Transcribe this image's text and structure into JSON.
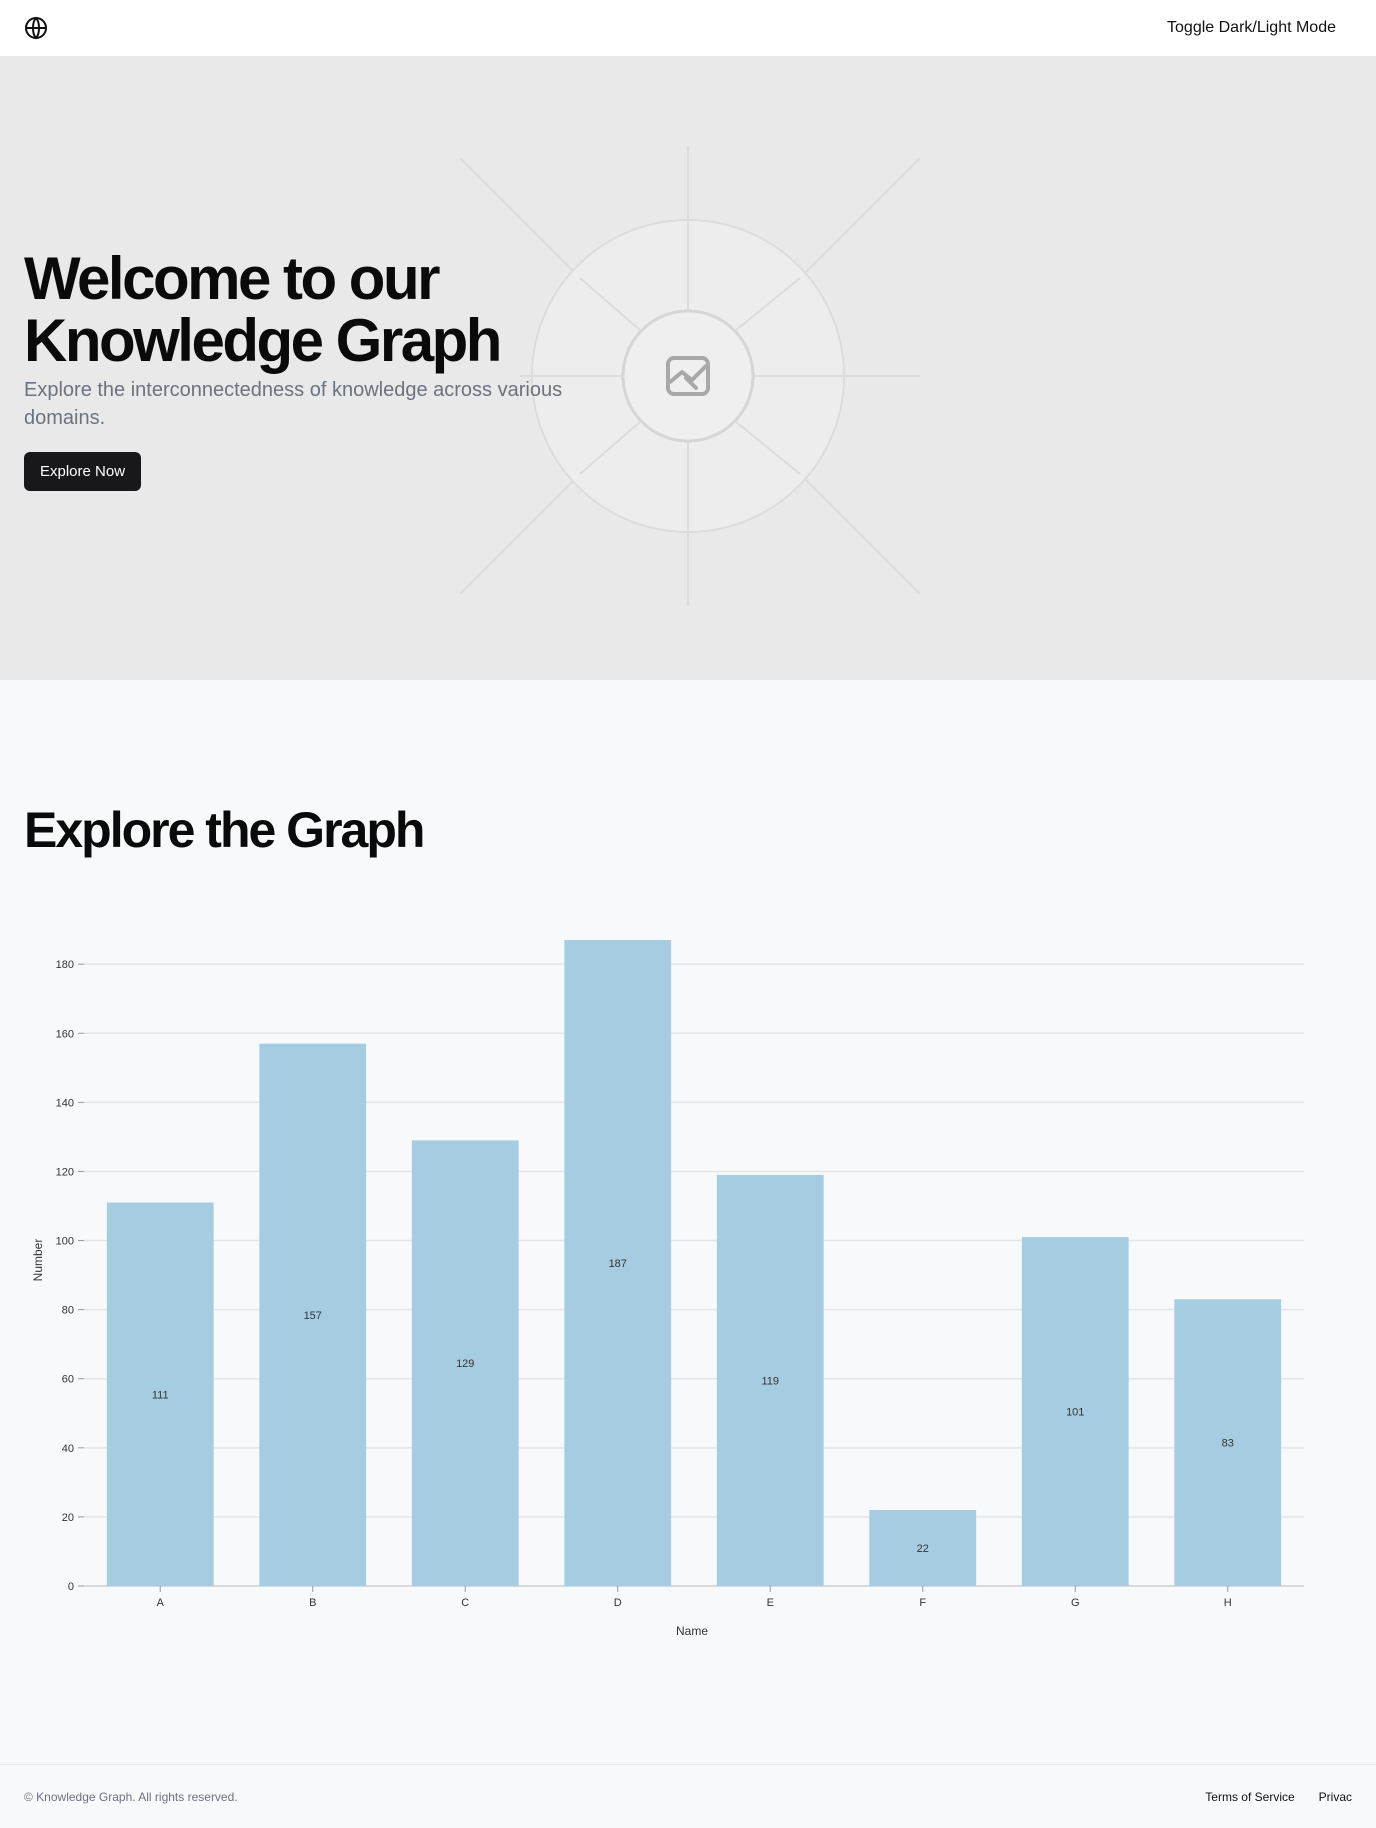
{
  "header": {
    "logo_icon": "globe-icon",
    "toggle_label": "Toggle Dark/Light Mode"
  },
  "hero": {
    "title_line1": "Welcome to our",
    "title_line2": "Knowledge Graph",
    "subtitle": "Explore the interconnectedness of knowledge across various domains.",
    "cta_label": "Explore Now",
    "image_icon": "image-placeholder-icon"
  },
  "graph_section": {
    "title": "Explore the Graph"
  },
  "chart_data": {
    "type": "bar",
    "categories": [
      "A",
      "B",
      "C",
      "D",
      "E",
      "F",
      "G",
      "H"
    ],
    "values": [
      111,
      157,
      129,
      187,
      119,
      22,
      101,
      83
    ],
    "xlabel": "Name",
    "ylabel": "Number",
    "ylim": [
      0,
      187
    ],
    "yticks": [
      0,
      20,
      40,
      60,
      80,
      100,
      120,
      140,
      160,
      180
    ],
    "grid": true,
    "bar_color": "#a6cce1",
    "data_labels": true
  },
  "footer": {
    "copyright": "© Knowledge Graph. All rights reserved.",
    "links": [
      "Terms of Service",
      "Privac"
    ]
  }
}
